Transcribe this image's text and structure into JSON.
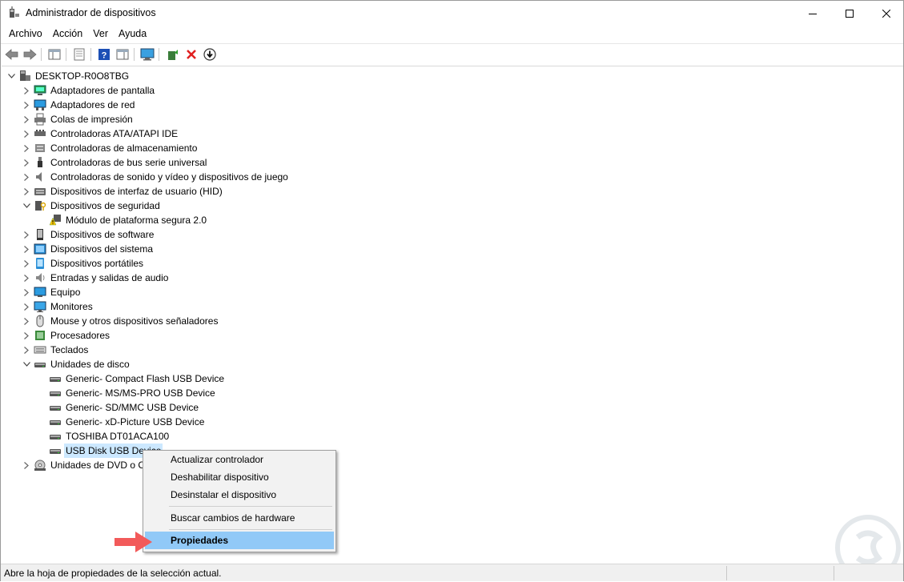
{
  "window": {
    "title": "Administrador de dispositivos"
  },
  "menu": [
    "Archivo",
    "Acción",
    "Ver",
    "Ayuda"
  ],
  "tree": {
    "root": "DESKTOP-R0O8TBG",
    "items": [
      {
        "label": "Adaptadores de pantalla",
        "icon": "display-adapter-icon",
        "expanded": false
      },
      {
        "label": "Adaptadores de red",
        "icon": "network-adapter-icon",
        "expanded": false
      },
      {
        "label": "Colas de impresión",
        "icon": "printer-icon",
        "expanded": false
      },
      {
        "label": "Controladoras ATA/ATAPI IDE",
        "icon": "ide-controller-icon",
        "expanded": false
      },
      {
        "label": "Controladoras de almacenamiento",
        "icon": "storage-controller-icon",
        "expanded": false
      },
      {
        "label": "Controladoras de bus serie universal",
        "icon": "usb-icon",
        "expanded": false
      },
      {
        "label": "Controladoras de sonido y vídeo y dispositivos de juego",
        "icon": "speaker-icon",
        "expanded": false
      },
      {
        "label": "Dispositivos de interfaz de usuario (HID)",
        "icon": "hid-icon",
        "expanded": false
      },
      {
        "label": "Dispositivos de seguridad",
        "icon": "security-device-icon",
        "expanded": true,
        "children": [
          {
            "label": "Módulo de plataforma segura 2.0",
            "icon": "warning-chip-icon"
          }
        ]
      },
      {
        "label": "Dispositivos de software",
        "icon": "software-device-icon",
        "expanded": false
      },
      {
        "label": "Dispositivos del sistema",
        "icon": "system-device-icon",
        "expanded": false
      },
      {
        "label": "Dispositivos portátiles",
        "icon": "portable-device-icon",
        "expanded": false
      },
      {
        "label": "Entradas y salidas de audio",
        "icon": "audio-io-icon",
        "expanded": false
      },
      {
        "label": "Equipo",
        "icon": "computer-icon",
        "expanded": false
      },
      {
        "label": "Monitores",
        "icon": "monitor-icon",
        "expanded": false
      },
      {
        "label": "Mouse y otros dispositivos señaladores",
        "icon": "mouse-icon",
        "expanded": false
      },
      {
        "label": "Procesadores",
        "icon": "processor-icon",
        "expanded": false
      },
      {
        "label": "Teclados",
        "icon": "keyboard-icon",
        "expanded": false
      },
      {
        "label": "Unidades de disco",
        "icon": "disk-drive-icon",
        "expanded": true,
        "children": [
          {
            "label": "Generic- Compact Flash USB Device",
            "icon": "disk-drive-icon"
          },
          {
            "label": "Generic- MS/MS-PRO USB Device",
            "icon": "disk-drive-icon"
          },
          {
            "label": "Generic- SD/MMC USB Device",
            "icon": "disk-drive-icon"
          },
          {
            "label": "Generic- xD-Picture USB Device",
            "icon": "disk-drive-icon"
          },
          {
            "label": "TOSHIBA DT01ACA100",
            "icon": "disk-drive-icon"
          },
          {
            "label": "USB Disk USB Device",
            "icon": "disk-drive-icon",
            "selected": true
          }
        ]
      },
      {
        "label": "Unidades de DVD o CD-ROM",
        "icon": "dvd-drive-icon",
        "expanded": false
      }
    ]
  },
  "context_menu": {
    "items": [
      {
        "label": "Actualizar controlador"
      },
      {
        "label": "Deshabilitar dispositivo"
      },
      {
        "label": "Desinstalar el dispositivo"
      },
      {
        "label": "Buscar cambios de hardware"
      },
      {
        "label": "Propiedades",
        "highlighted": true
      }
    ]
  },
  "status": {
    "text": "Abre la hoja de propiedades de la selección actual."
  },
  "colors": {
    "selection": "#cce8ff",
    "menu_highlight": "#91c9f7",
    "arrow": "#f25a5a"
  }
}
